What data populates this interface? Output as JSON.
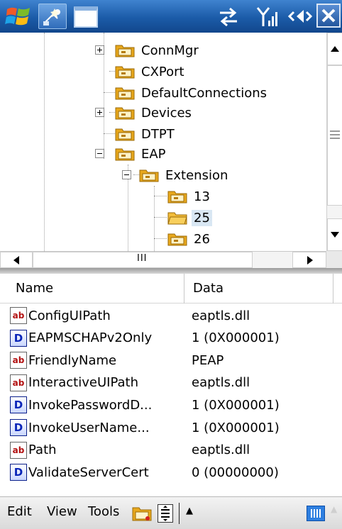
{
  "status_bar": {
    "start_icon": "windows-flag-icon",
    "task_icon": "task-manager-icon",
    "window_icon": "window-icon",
    "connectivity_icon": "connectivity-arrows-icon",
    "signal_icon": "signal-strength-icon",
    "volume_icon": "speaker-volume-icon",
    "close_icon": "close-icon"
  },
  "tree": {
    "nodes": [
      {
        "label": "ConnMgr",
        "expander": "plus",
        "selected": false
      },
      {
        "label": "CXPort",
        "expander": "none",
        "selected": false
      },
      {
        "label": "DefaultConnections",
        "expander": "none",
        "selected": false
      },
      {
        "label": "Devices",
        "expander": "plus",
        "selected": false
      },
      {
        "label": "DTPT",
        "expander": "none",
        "selected": false
      },
      {
        "label": "EAP",
        "expander": "minus",
        "selected": false
      },
      {
        "label": "Extension",
        "expander": "minus",
        "selected": false
      },
      {
        "label": "13",
        "expander": "none",
        "selected": false
      },
      {
        "label": "25",
        "expander": "none",
        "selected": true
      },
      {
        "label": "26",
        "expander": "none",
        "selected": false
      }
    ]
  },
  "scrollbars": {
    "horizontal_thumb_grip": "III"
  },
  "list": {
    "columns": [
      "Name",
      "Data"
    ],
    "rows": [
      {
        "type": "string",
        "icon": "string-value-icon",
        "name": "ConfigUIPath",
        "data": "eaptls.dll"
      },
      {
        "type": "dword",
        "icon": "dword-value-icon",
        "name": "EAPMSCHAPv2Only",
        "data": "1 (0X000001)"
      },
      {
        "type": "string",
        "icon": "string-value-icon",
        "name": "FriendlyName",
        "data": "PEAP"
      },
      {
        "type": "string",
        "icon": "string-value-icon",
        "name": "InteractiveUIPath",
        "data": "eaptls.dll"
      },
      {
        "type": "dword",
        "icon": "dword-value-icon",
        "name": "InvokePasswordD...",
        "data": "1 (0X000001)"
      },
      {
        "type": "dword",
        "icon": "dword-value-icon",
        "name": "InvokeUserName...",
        "data": "1 (0X000001)"
      },
      {
        "type": "string",
        "icon": "string-value-icon",
        "name": "Path",
        "data": "eaptls.dll"
      },
      {
        "type": "dword",
        "icon": "dword-value-icon",
        "name": "ValidateServerCert",
        "data": "0 (00000000)"
      }
    ]
  },
  "menubar": {
    "edit": "Edit",
    "view": "View",
    "tools": "Tools",
    "sip_arrow": "▲",
    "kbd_arrow": "▲"
  },
  "colors": {
    "titlebar": "#1b5ba8",
    "selection": "#d9e7f3",
    "folder": "#e8a81c"
  }
}
